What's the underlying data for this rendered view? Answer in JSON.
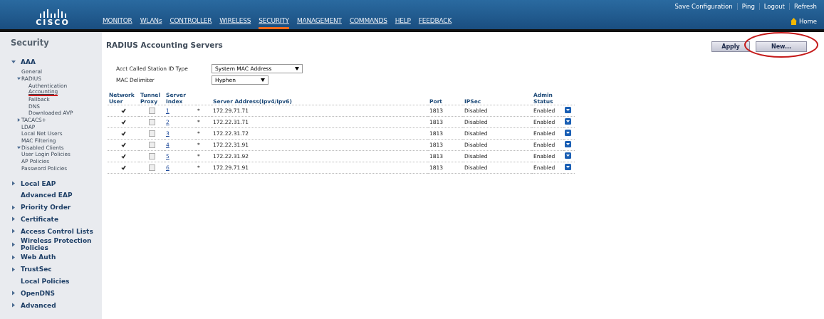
{
  "header": {
    "logo_text": "CISCO",
    "nav": [
      {
        "label": "MONITOR",
        "selected": false
      },
      {
        "label": "WLANs",
        "selected": false
      },
      {
        "label": "CONTROLLER",
        "selected": false
      },
      {
        "label": "WIRELESS",
        "selected": false
      },
      {
        "label": "SECURITY",
        "selected": true
      },
      {
        "label": "MANAGEMENT",
        "selected": false
      },
      {
        "label": "COMMANDS",
        "selected": false
      },
      {
        "label": "HELP",
        "selected": false
      },
      {
        "label": "FEEDBACK",
        "selected": false
      }
    ],
    "top_links": [
      "Save Configuration",
      "Ping",
      "Logout",
      "Refresh"
    ],
    "home": "Home"
  },
  "sidebar": {
    "title": "Security",
    "items": [
      {
        "label": "AAA",
        "expanded": true,
        "children": [
          {
            "label": "General"
          },
          {
            "label": "RADIUS",
            "expanded": true,
            "children": [
              {
                "label": "Authentication",
                "selected": false
              },
              {
                "label": "Accounting",
                "selected": true
              },
              {
                "label": "Fallback",
                "selected": false
              },
              {
                "label": "DNS",
                "selected": false
              },
              {
                "label": "Downloaded AVP",
                "selected": false
              }
            ]
          },
          {
            "label": "TACACS+",
            "expanded": false
          },
          {
            "label": "LDAP"
          },
          {
            "label": "Local Net Users"
          },
          {
            "label": "MAC Filtering"
          },
          {
            "label": "Disabled Clients",
            "expanded": true
          },
          {
            "label": "User Login Policies"
          },
          {
            "label": "AP Policies"
          },
          {
            "label": "Password Policies"
          }
        ]
      },
      {
        "label": "Local EAP",
        "expanded": false
      },
      {
        "label": "Advanced EAP"
      },
      {
        "label": "Priority Order",
        "expanded": false
      },
      {
        "label": "Certificate",
        "expanded": false
      },
      {
        "label": "Access Control Lists",
        "expanded": false
      },
      {
        "label": "Wireless Protection Policies",
        "expanded": false
      },
      {
        "label": "Web Auth",
        "expanded": false
      },
      {
        "label": "TrustSec",
        "expanded": false
      },
      {
        "label": "Local Policies"
      },
      {
        "label": "OpenDNS",
        "expanded": false
      },
      {
        "label": "Advanced",
        "expanded": false
      }
    ]
  },
  "page": {
    "title": "RADIUS Accounting Servers",
    "buttons": [
      {
        "label": "Apply",
        "highlighted": false
      },
      {
        "label": "New...",
        "highlighted": true
      }
    ],
    "fields": [
      {
        "label": "Acct Called Station ID Type",
        "value": "System MAC Address"
      },
      {
        "label": "MAC Delimiter",
        "value": "Hyphen"
      }
    ],
    "table": {
      "columns": [
        "Network User",
        "Tunnel Proxy",
        "Server Index",
        "Server Address(Ipv4/Ipv6)",
        "Port",
        "IPSec",
        "Admin Status"
      ],
      "rows": [
        {
          "network_user": true,
          "tunnel_proxy": false,
          "index": "1",
          "mark": "*",
          "address": "172.29.71.71",
          "port": "1813",
          "ipsec": "Disabled",
          "admin_status": "Enabled"
        },
        {
          "network_user": true,
          "tunnel_proxy": false,
          "index": "2",
          "mark": "*",
          "address": "172.22.31.71",
          "port": "1813",
          "ipsec": "Disabled",
          "admin_status": "Enabled"
        },
        {
          "network_user": true,
          "tunnel_proxy": false,
          "index": "3",
          "mark": "*",
          "address": "172.22.31.72",
          "port": "1813",
          "ipsec": "Disabled",
          "admin_status": "Enabled"
        },
        {
          "network_user": true,
          "tunnel_proxy": false,
          "index": "4",
          "mark": "*",
          "address": "172.22.31.91",
          "port": "1813",
          "ipsec": "Disabled",
          "admin_status": "Enabled"
        },
        {
          "network_user": true,
          "tunnel_proxy": false,
          "index": "5",
          "mark": "*",
          "address": "172.22.31.92",
          "port": "1813",
          "ipsec": "Disabled",
          "admin_status": "Enabled"
        },
        {
          "network_user": true,
          "tunnel_proxy": false,
          "index": "6",
          "mark": "*",
          "address": "172.29.71.91",
          "port": "1813",
          "ipsec": "Disabled",
          "admin_status": "Enabled"
        }
      ]
    }
  }
}
